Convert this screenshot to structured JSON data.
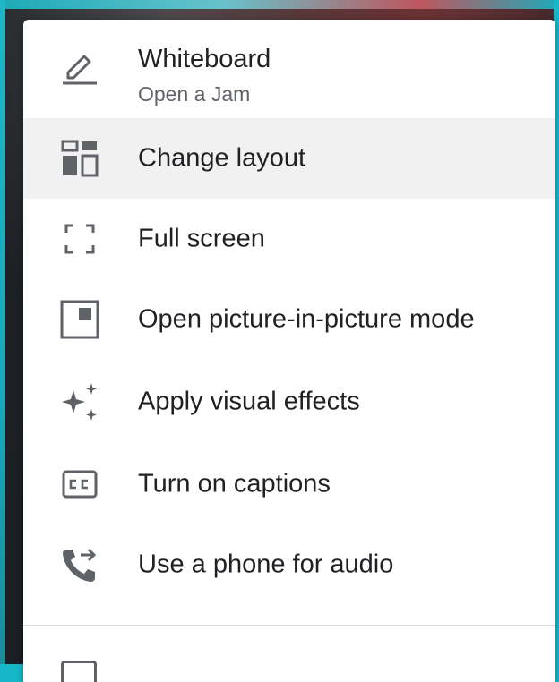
{
  "menu": {
    "whiteboard": {
      "label": "Whiteboard",
      "sublabel": "Open a Jam",
      "icon": "pencil-icon"
    },
    "items": [
      {
        "label": "Change layout",
        "icon": "layout-icon",
        "highlighted": true
      },
      {
        "label": "Full screen",
        "icon": "fullscreen-icon",
        "highlighted": false
      },
      {
        "label": "Open picture-in-picture mode",
        "icon": "picture-in-picture-icon",
        "highlighted": false
      },
      {
        "label": "Apply visual effects",
        "icon": "sparkle-icon",
        "highlighted": false
      },
      {
        "label": "Turn on captions",
        "icon": "captions-icon",
        "highlighted": false
      },
      {
        "label": "Use a phone for audio",
        "icon": "phone-forward-icon",
        "highlighted": false
      }
    ],
    "partial_item": {
      "icon": "report-icon"
    }
  },
  "colors": {
    "menu_background": "#ffffff",
    "highlight_background": "#f1f1f1",
    "text_primary": "#202124",
    "text_secondary": "#5f6368",
    "icon_color": "#5f6368",
    "frame_accent": "#16b8c7"
  }
}
